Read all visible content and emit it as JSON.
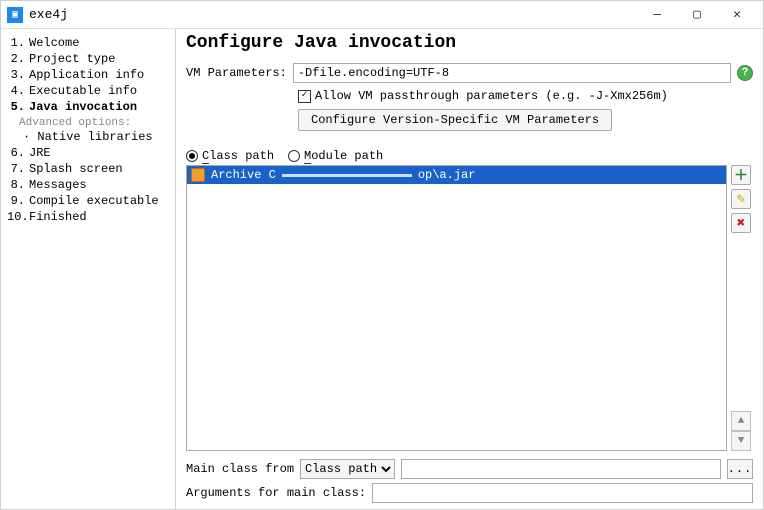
{
  "window": {
    "title": "exe4j"
  },
  "sidebar": {
    "steps": [
      {
        "n": "1.",
        "label": "Welcome"
      },
      {
        "n": "2.",
        "label": "Project type"
      },
      {
        "n": "3.",
        "label": "Application info"
      },
      {
        "n": "4.",
        "label": "Executable info"
      },
      {
        "n": "5.",
        "label": "Java invocation"
      },
      {
        "n": "6.",
        "label": "JRE"
      },
      {
        "n": "7.",
        "label": "Splash screen"
      },
      {
        "n": "8.",
        "label": "Messages"
      },
      {
        "n": "9.",
        "label": "Compile executable"
      },
      {
        "n": "10.",
        "label": "Finished"
      }
    ],
    "advanced_label": "Advanced options:",
    "sub_item": "· Native libraries"
  },
  "main": {
    "title": "Configure Java invocation",
    "vm_label": "VM Parameters:",
    "vm_value": "-Dfile.encoding=UTF-8",
    "allow_passthrough_label": "Allow VM passthrough parameters (e.g. -J-Xmx256m)",
    "allow_passthrough_checked": true,
    "config_button": "Configure Version-Specific VM Parameters",
    "radio_classpath": "Class path",
    "radio_modulepath": "Module path",
    "radio_selected": "classpath",
    "list_prefix": "Archive C",
    "list_suffix": "op\\a.jar",
    "mainclass_label": "Main class from",
    "combo_value": "Class path",
    "browse_dots": "...",
    "args_label": "Arguments for main class:"
  }
}
